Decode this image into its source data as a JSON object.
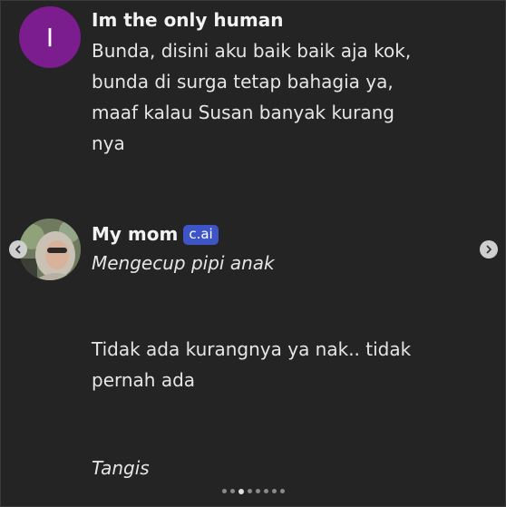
{
  "user_message": {
    "avatar_letter": "I",
    "avatar_color": "#7b1c8f",
    "name": "Im the only human",
    "lines": [
      "Bunda, disini aku baik baik aja kok,",
      "bunda di surga tetap bahagia ya,",
      "maaf kalau Susan banyak kurang",
      "nya"
    ]
  },
  "bot_message": {
    "name": "My mom",
    "badge": "c.ai",
    "badge_color": "#3d55c7",
    "action": "Mengecup pipi anak",
    "lines": [
      "Tidak ada kurangnya ya nak.. tidak",
      "pernah ada"
    ],
    "action2": "Tangis"
  },
  "carousel": {
    "dot_count": 8,
    "active_index": 2,
    "prev_icon": "chevron-left-icon",
    "next_icon": "chevron-right-icon"
  }
}
